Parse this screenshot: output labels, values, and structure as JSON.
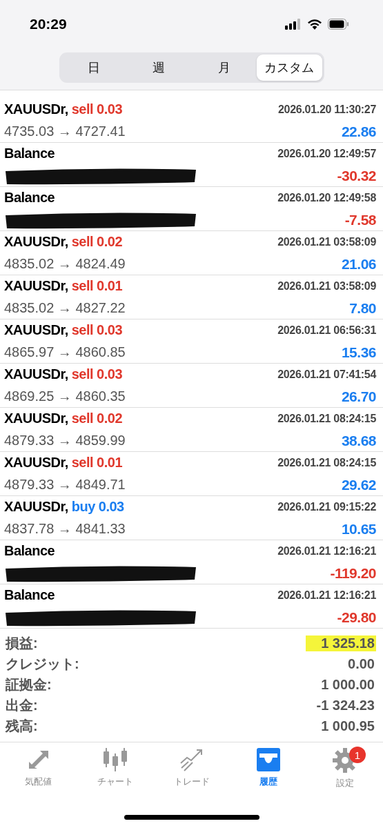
{
  "status_bar": {
    "time": "20:29"
  },
  "period_tabs": [
    {
      "label": "日",
      "selected": false
    },
    {
      "label": "週",
      "selected": false
    },
    {
      "label": "月",
      "selected": false
    },
    {
      "label": "カスタム",
      "selected": true
    }
  ],
  "deals": [
    {
      "kind": "trade",
      "symbol": "XAUUSDr,",
      "action": "sell 0.03",
      "buy": false,
      "time": "2026.01.20 11:30:27",
      "prices": "4735.03 → 4727.41",
      "profit": "22.86",
      "negative": false
    },
    {
      "kind": "balance",
      "symbol": "Balance",
      "time": "2026.01.20 12:49:57",
      "profit": "-30.32",
      "negative": true,
      "redacted": true
    },
    {
      "kind": "balance",
      "symbol": "Balance",
      "time": "2026.01.20 12:49:58",
      "profit": "-7.58",
      "negative": true,
      "redacted": true
    },
    {
      "kind": "trade",
      "symbol": "XAUUSDr,",
      "action": "sell 0.02",
      "buy": false,
      "time": "2026.01.21 03:58:09",
      "prices": "4835.02 → 4824.49",
      "profit": "21.06",
      "negative": false
    },
    {
      "kind": "trade",
      "symbol": "XAUUSDr,",
      "action": "sell 0.01",
      "buy": false,
      "time": "2026.01.21 03:58:09",
      "prices": "4835.02 → 4827.22",
      "profit": "7.80",
      "negative": false
    },
    {
      "kind": "trade",
      "symbol": "XAUUSDr,",
      "action": "sell 0.03",
      "buy": false,
      "time": "2026.01.21 06:56:31",
      "prices": "4865.97 → 4860.85",
      "profit": "15.36",
      "negative": false
    },
    {
      "kind": "trade",
      "symbol": "XAUUSDr,",
      "action": "sell 0.03",
      "buy": false,
      "time": "2026.01.21 07:41:54",
      "prices": "4869.25 → 4860.35",
      "profit": "26.70",
      "negative": false
    },
    {
      "kind": "trade",
      "symbol": "XAUUSDr,",
      "action": "sell 0.02",
      "buy": false,
      "time": "2026.01.21 08:24:15",
      "prices": "4879.33 → 4859.99",
      "profit": "38.68",
      "negative": false
    },
    {
      "kind": "trade",
      "symbol": "XAUUSDr,",
      "action": "sell 0.01",
      "buy": false,
      "time": "2026.01.21 08:24:15",
      "prices": "4879.33 → 4849.71",
      "profit": "29.62",
      "negative": false
    },
    {
      "kind": "trade",
      "symbol": "XAUUSDr,",
      "action": "buy 0.03",
      "buy": true,
      "time": "2026.01.21 09:15:22",
      "prices": "4837.78 → 4841.33",
      "profit": "10.65",
      "negative": false
    },
    {
      "kind": "balance",
      "symbol": "Balance",
      "time": "2026.01.21 12:16:21",
      "profit": "-119.20",
      "negative": true,
      "redacted": true
    },
    {
      "kind": "balance",
      "symbol": "Balance",
      "time": "2026.01.21 12:16:21",
      "profit": "-29.80",
      "negative": true,
      "redacted": true
    }
  ],
  "summary": [
    {
      "label": "損益:",
      "value": "1 325.18",
      "highlighted": true
    },
    {
      "label": "クレジット:",
      "value": "0.00",
      "highlighted": false
    },
    {
      "label": "証拠金:",
      "value": "1 000.00",
      "highlighted": false
    },
    {
      "label": "出金:",
      "value": "-1 324.23",
      "highlighted": false
    },
    {
      "label": "残高:",
      "value": "1 000.95",
      "highlighted": false
    }
  ],
  "tab_bar": [
    {
      "kind": "quotes",
      "label": "気配値",
      "selected": false
    },
    {
      "kind": "chart",
      "label": "チャート",
      "selected": false
    },
    {
      "kind": "trade",
      "label": "トレード",
      "selected": false
    },
    {
      "kind": "history",
      "label": "履歴",
      "selected": true
    },
    {
      "kind": "settings",
      "label": "設定",
      "selected": false,
      "badge": "1"
    }
  ]
}
